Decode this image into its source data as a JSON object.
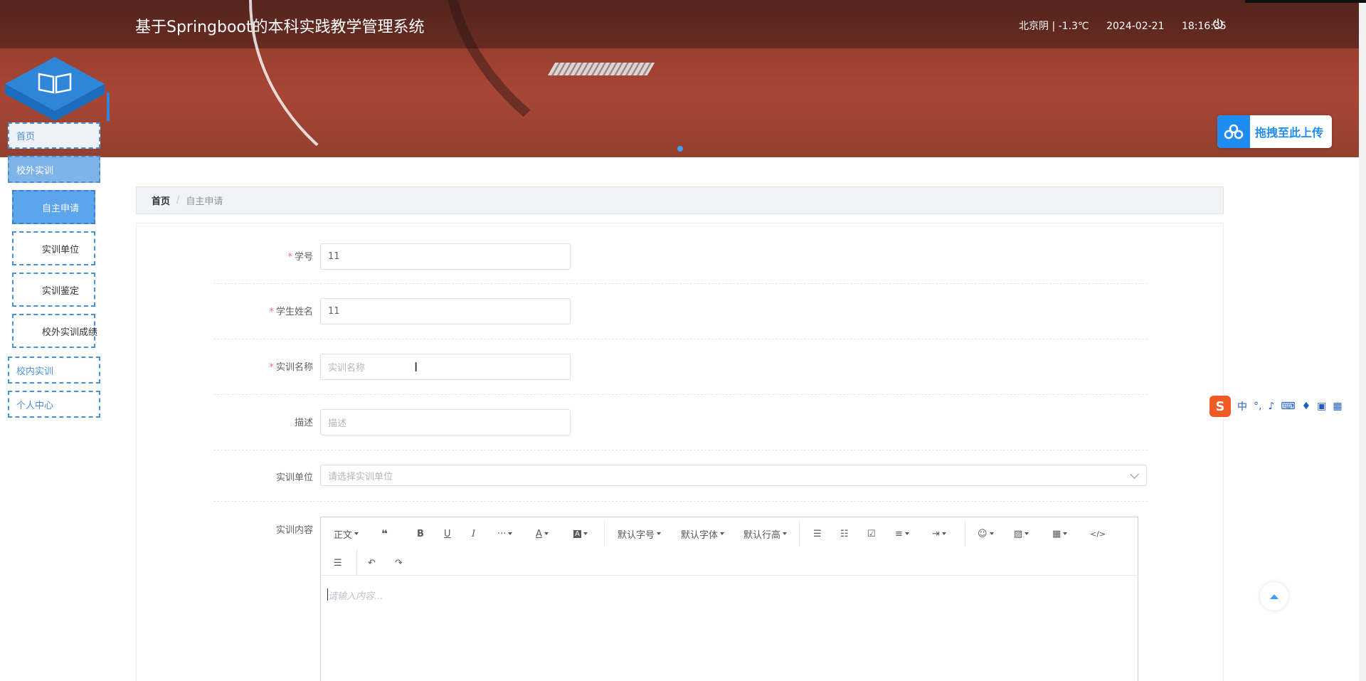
{
  "header": {
    "site_title": "基于Springboot的本科实践教学管理系统",
    "weather": "北京阴 | -1.3℃",
    "date": "2024-02-21",
    "time": "18:16:35",
    "upload_label": "拖拽至此上传"
  },
  "sidebar": {
    "items": [
      {
        "label": "首页"
      },
      {
        "label": "校外实训"
      },
      {
        "label": "自主申请"
      },
      {
        "label": "实训单位"
      },
      {
        "label": "实训鉴定"
      },
      {
        "label": "校外实训成绩"
      },
      {
        "label": "校内实训"
      },
      {
        "label": "个人中心"
      }
    ]
  },
  "breadcrumb": {
    "home": "首页",
    "separator": "/",
    "current": "自主申请"
  },
  "form": {
    "student_id": {
      "label": "学号",
      "value": "11"
    },
    "student_name": {
      "label": "学生姓名",
      "value": "11"
    },
    "training_name": {
      "label": "实训名称",
      "placeholder": "实训名称"
    },
    "description": {
      "label": "描述",
      "placeholder": "描述"
    },
    "training_unit": {
      "label": "实训单位",
      "placeholder": "请选择实训单位"
    },
    "training_content": {
      "label": "实训内容",
      "placeholder": "请输入内容..."
    }
  },
  "editor_toolbar": {
    "paragraph": "正文",
    "font_size": "默认字号",
    "font_family": "默认字体",
    "line_height": "默认行高"
  },
  "ime": {
    "mode": "中"
  },
  "colors": {
    "accent": "#409eff",
    "required": "#f56c6c",
    "sidebar_active": "#5aa5ec"
  }
}
